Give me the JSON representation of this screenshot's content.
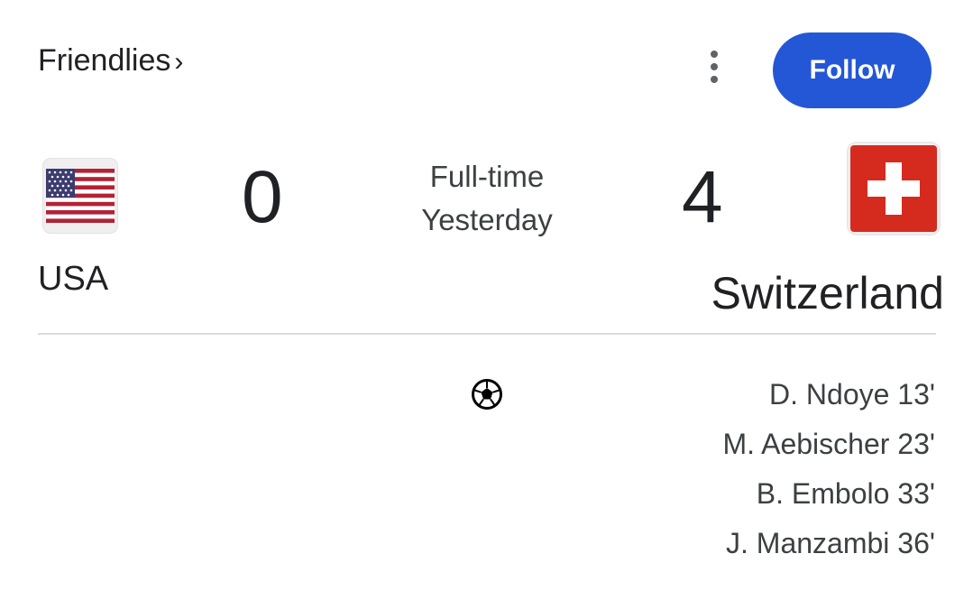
{
  "header": {
    "competition": "Friendlies",
    "competition_chevron": "›",
    "more_icon": "more-vert-icon",
    "follow_label": "Follow"
  },
  "match": {
    "home": {
      "name": "USA",
      "score": "0",
      "flag_icon": "usa-flag-icon"
    },
    "away": {
      "name": "Switzerland",
      "score": "4",
      "flag_icon": "switzerland-flag-icon"
    },
    "status": "Full-time",
    "date": "Yesterday"
  },
  "goals": {
    "icon": "soccer-ball-icon",
    "away_scorers": [
      "D. Ndoye 13'",
      "M. Aebischer 23'",
      "B. Embolo 33'",
      "J. Manzambi 36'"
    ]
  },
  "colors": {
    "accent": "#2357d6",
    "text": "#202124",
    "divider": "#dadce0",
    "swiss_red": "#d52b1e",
    "usa_red": "#b22234",
    "usa_blue": "#3c3b6e"
  }
}
